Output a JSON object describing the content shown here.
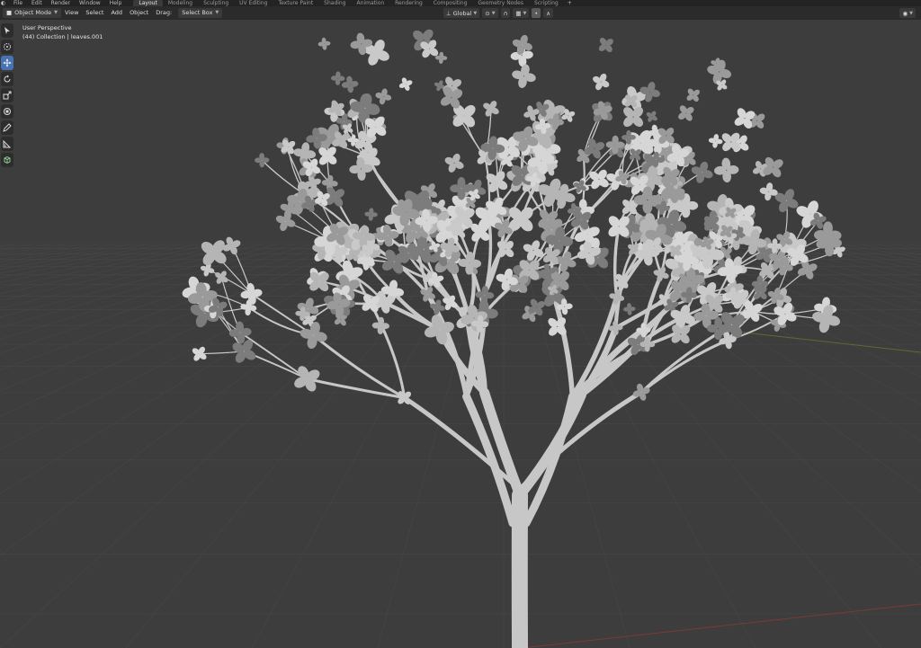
{
  "menu": {
    "items": [
      "File",
      "Edit",
      "Render",
      "Window",
      "Help"
    ]
  },
  "workspaces": {
    "tabs": [
      "Layout",
      "Modeling",
      "Sculpting",
      "UV Editing",
      "Texture Paint",
      "Shading",
      "Animation",
      "Rendering",
      "Compositing",
      "Geometry Nodes",
      "Scripting"
    ],
    "active": "Layout",
    "add_label": "+"
  },
  "header": {
    "mode": "Object Mode",
    "view": "View",
    "select": "Select",
    "add": "Add",
    "object": "Object",
    "drag_label": "Drag:",
    "drag_value": "Select Box",
    "transform_orientation": "Global"
  },
  "toolbar": {
    "tools": [
      "select-box",
      "cursor",
      "move",
      "rotate",
      "scale",
      "transform",
      "annotate",
      "measure",
      "add-cube"
    ],
    "active": "move"
  },
  "viewport": {
    "view_name": "User Perspective",
    "collection_info": "(44) Collection | leaves.001"
  },
  "colors": {
    "background": "#3d3d3d",
    "grid": "#474747",
    "active_tool": "#4772b3",
    "x_axis": "#7a3a3a",
    "y_axis": "#5f6a32",
    "tree": "#c7c7c7"
  }
}
